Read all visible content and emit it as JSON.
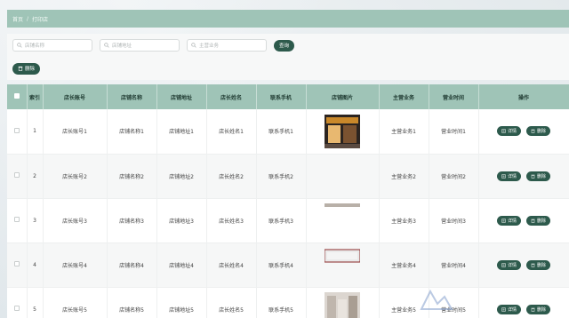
{
  "breadcrumb": {
    "home": "首页",
    "separator": "/",
    "current": "打印店"
  },
  "search": {
    "field1_placeholder": "店铺名称",
    "field2_placeholder": "店铺地址",
    "field3_placeholder": "主营业务",
    "button_label": "查询"
  },
  "actions": {
    "delete_label": "删除"
  },
  "table": {
    "headers": [
      "索引",
      "店长账号",
      "店铺名称",
      "店铺地址",
      "店长姓名",
      "联系手机",
      "店铺图片",
      "主营业务",
      "营业时间",
      "操作"
    ],
    "rows": [
      {
        "index": "1",
        "account": "店长账号1",
        "name": "店铺名称1",
        "address": "店铺地址1",
        "manager": "店长姓名1",
        "phone": "联系手机1",
        "business": "主营业务1",
        "hours": "营业时间1",
        "image": "storefront"
      },
      {
        "index": "2",
        "account": "店长账号2",
        "name": "店铺名称2",
        "address": "店铺地址2",
        "manager": "店长姓名2",
        "phone": "联系手机2",
        "business": "主营业务2",
        "hours": "营业时间2",
        "image": "none"
      },
      {
        "index": "3",
        "account": "店长账号3",
        "name": "店铺名称3",
        "address": "店铺地址3",
        "manager": "店长姓名3",
        "phone": "联系手机3",
        "business": "主营业务3",
        "hours": "营业时间3",
        "image": "strip"
      },
      {
        "index": "4",
        "account": "店长账号4",
        "name": "店铺名称4",
        "address": "店铺地址4",
        "manager": "店长姓名4",
        "phone": "联系手机4",
        "business": "主营业务4",
        "hours": "营业时间4",
        "image": "wall"
      },
      {
        "index": "5",
        "account": "店长账号5",
        "name": "店铺名称5",
        "address": "店铺地址5",
        "manager": "店长姓名5",
        "phone": "联系手机5",
        "business": "主营业务5",
        "hours": "营业时间5",
        "image": "interior"
      }
    ],
    "detail_label": "详情",
    "delete_label": "删除"
  },
  "colors": {
    "accent": "#2d5a4c",
    "header": "#9fc4b7"
  }
}
